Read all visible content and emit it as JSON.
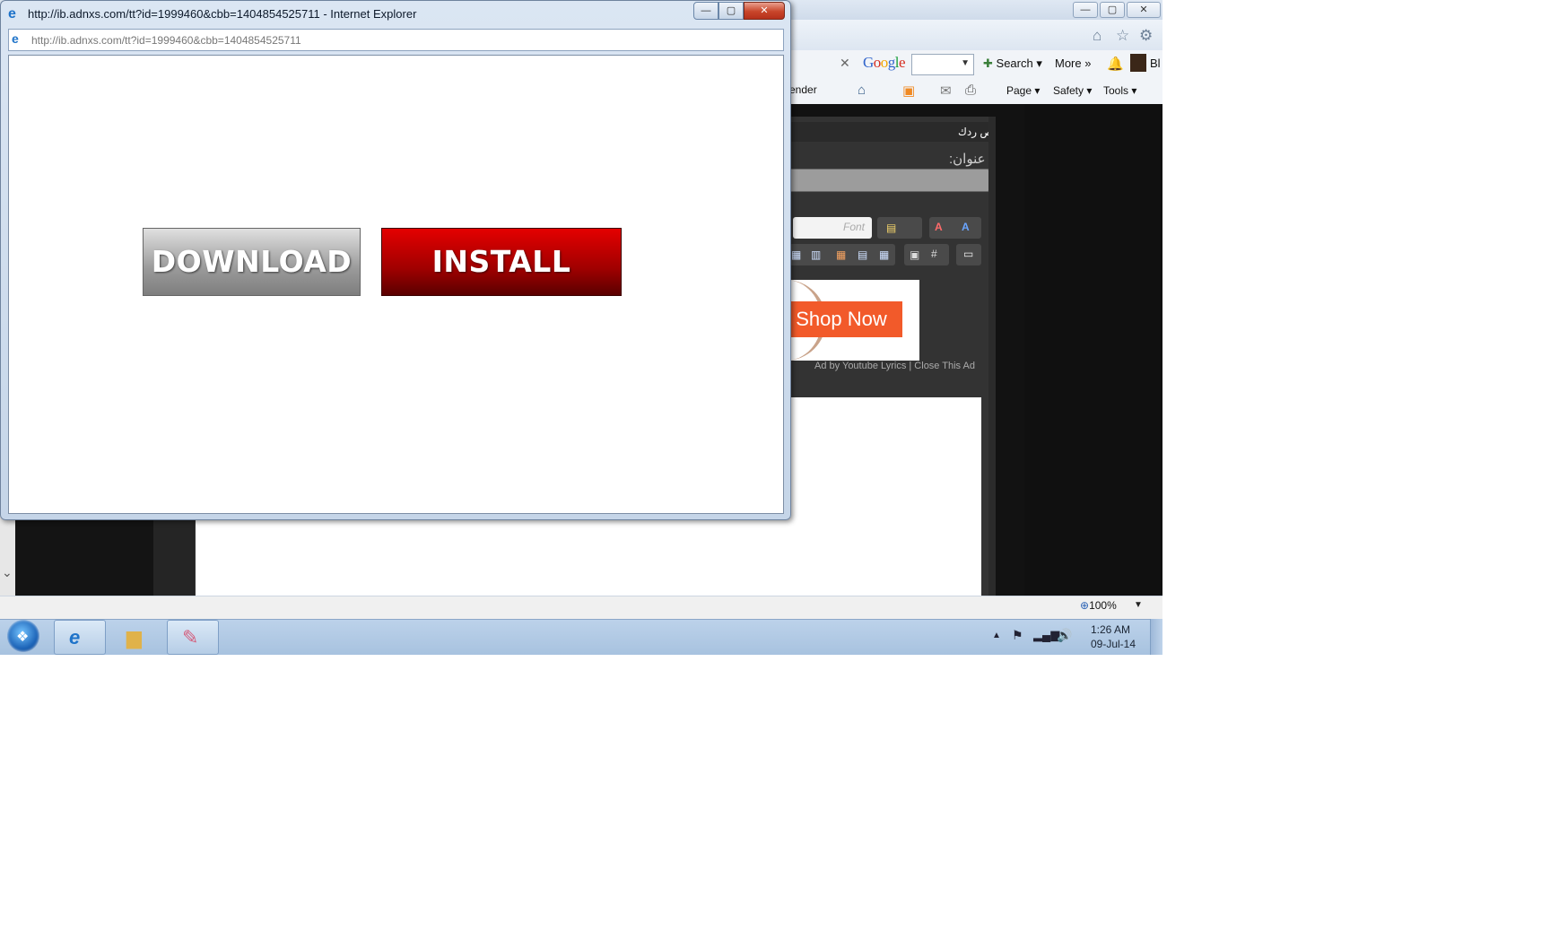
{
  "popup": {
    "title": "http://ib.adnxs.com/tt?id=1999460&cbb=1404854525711 - Internet Explorer",
    "address": "http://ib.adnxs.com/tt?id=1999460&cbb=1404854525711",
    "download_label": "DOWNLOAD",
    "install_label": "INSTALL",
    "close_glyph": "✕",
    "minimize_glyph": "—",
    "maximize_glyph": "▢"
  },
  "browser": {
    "google_logo": "Google",
    "search_label": "Search",
    "more_label": "More »",
    "bl_label": "Bl",
    "cmd_partial": "ender",
    "page_label": "Page ▾",
    "safety_label": "Safety ▾",
    "tools_label": "Tools ▾",
    "zoom": "100%"
  },
  "page": {
    "tab_label": "نص ردك",
    "title_label": "عنوان:",
    "font_placeholder": "Font",
    "ad_button": "Shop Now",
    "ad_credit": "Ad by Youtube Lyrics | Close This Ad"
  },
  "taskbar": {
    "time": "1:26 AM",
    "date": "09-Jul-14"
  },
  "colors": {
    "install_red": "#c00000",
    "download_gray": "#8c8c8c",
    "shop_orange": "#f25a2a"
  }
}
